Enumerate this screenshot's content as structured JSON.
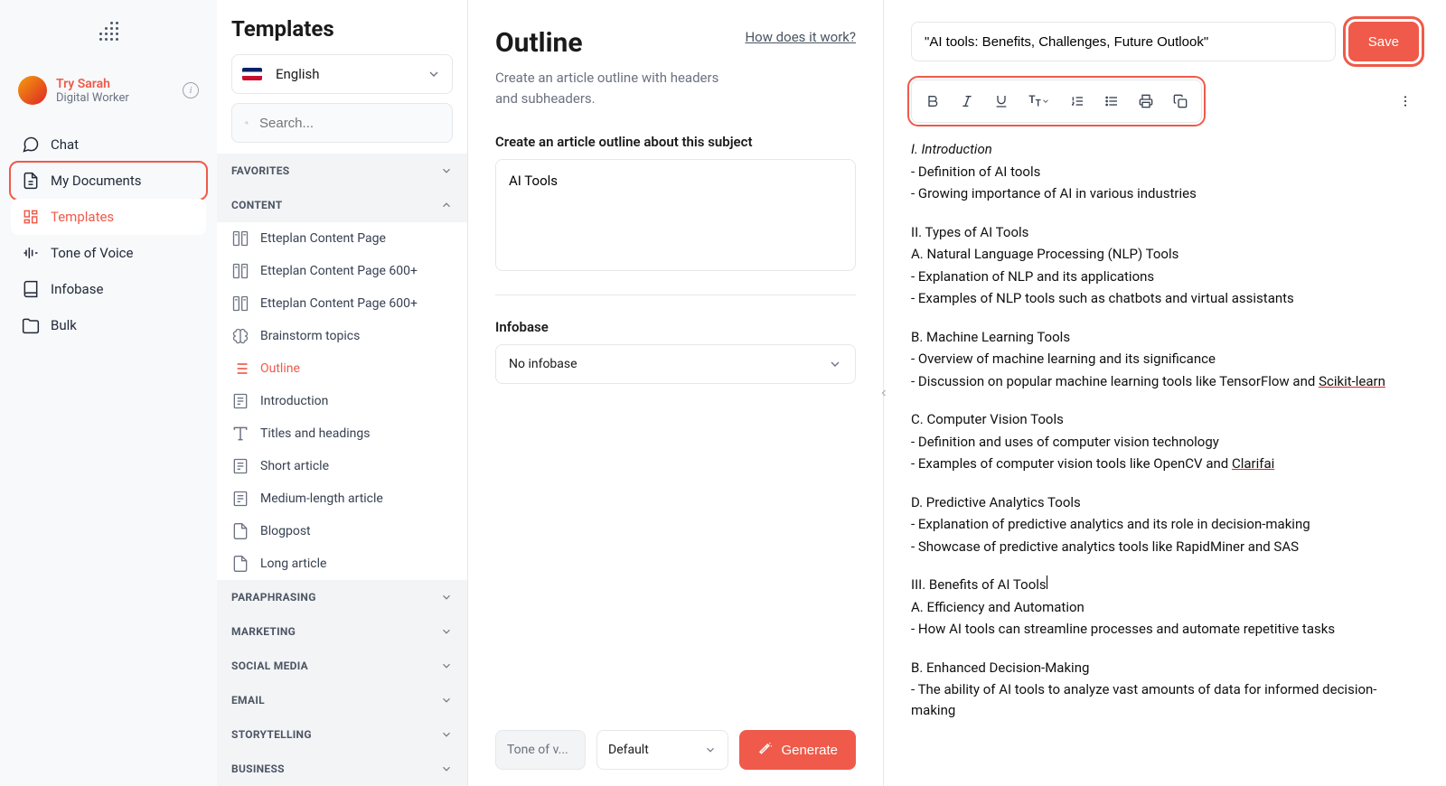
{
  "user": {
    "name": "Try Sarah",
    "role": "Digital Worker"
  },
  "nav": {
    "chat": "Chat",
    "my_documents": "My Documents",
    "templates": "Templates",
    "tone": "Tone of Voice",
    "infobase": "Infobase",
    "bulk": "Bulk"
  },
  "templates": {
    "title": "Templates",
    "language": "English",
    "search_placeholder": "Search...",
    "groups": {
      "favorites": "FAVORITES",
      "content": "CONTENT",
      "paraphrasing": "PARAPHRASING",
      "marketing": "MARKETING",
      "social_media": "SOCIAL MEDIA",
      "email": "EMAIL",
      "storytelling": "STORYTELLING",
      "business": "BUSINESS"
    },
    "content_items": [
      "Etteplan Content Page",
      "Etteplan Content Page 600+",
      "Etteplan Content Page 600+",
      "Brainstorm topics",
      "Outline",
      "Introduction",
      "Titles and headings",
      "Short article",
      "Medium-length article",
      "Blogpost",
      "Long article"
    ]
  },
  "form": {
    "title": "Outline",
    "description": "Create an article outline with headers and subheaders.",
    "how_link": "How does it work?",
    "subject_label": "Create an article outline about this subject",
    "subject_value": "AI Tools",
    "infobase_label": "Infobase",
    "infobase_value": "No infobase",
    "tone_label": "Tone of v...",
    "default_label": "Default",
    "generate": "Generate"
  },
  "editor": {
    "title": "\"AI tools: Benefits, Challenges, Future Outlook\"",
    "save": "Save",
    "lines": [
      {
        "t": "I. Introduction",
        "i": true
      },
      {
        "t": "- Definition of AI tools"
      },
      {
        "t": "- Growing importance of AI in various industries"
      },
      {
        "sp": true
      },
      {
        "t": "II. Types of AI Tools"
      },
      {
        "t": "A. Natural Language Processing (NLP) Tools"
      },
      {
        "t": "- Explanation of NLP and its applications"
      },
      {
        "t": "- Examples of NLP tools such as chatbots and virtual assistants"
      },
      {
        "sp": true
      },
      {
        "t": "B. Machine Learning Tools"
      },
      {
        "t": "- Overview of machine learning and its significance"
      },
      {
        "t": "- Discussion on popular machine learning tools like TensorFlow and ",
        "u": "Scikit-learn"
      },
      {
        "sp": true
      },
      {
        "t": "C. Computer Vision Tools"
      },
      {
        "t": "- Definition and uses of computer vision technology"
      },
      {
        "t": "- Examples of computer vision tools like OpenCV and ",
        "u": "Clarifai"
      },
      {
        "sp": true
      },
      {
        "t": "D. Predictive Analytics Tools"
      },
      {
        "t": "- Explanation of predictive analytics and its role in decision-making"
      },
      {
        "t": "- Showcase of predictive analytics tools like RapidMiner and SAS"
      },
      {
        "sp": true
      },
      {
        "t": "III. Benefits of AI Tools",
        "cursor": true
      },
      {
        "t": "A. Efficiency and Automation"
      },
      {
        "t": "- How AI tools can streamline processes and automate repetitive tasks"
      },
      {
        "sp": true
      },
      {
        "t": "B. Enhanced Decision-Making"
      },
      {
        "t": "- The ability of AI tools to analyze vast amounts of data for informed decision-making"
      }
    ]
  }
}
